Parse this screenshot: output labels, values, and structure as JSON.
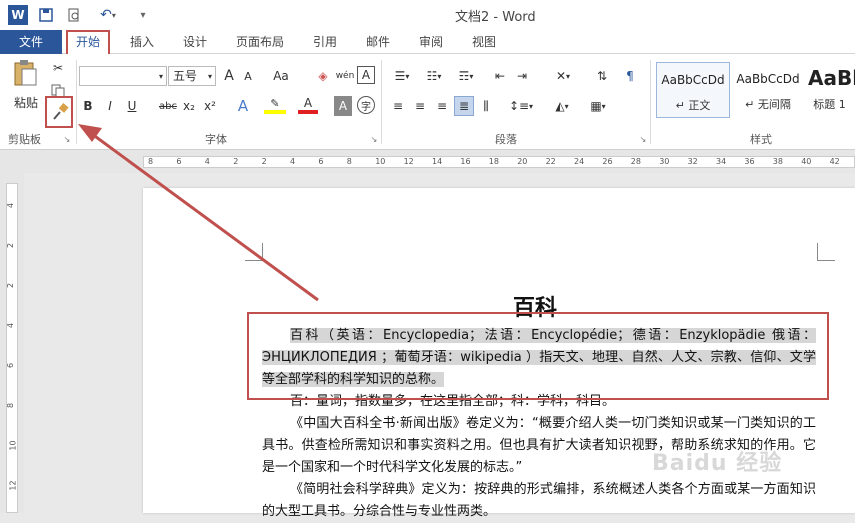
{
  "app": {
    "title": "文档2 - Word"
  },
  "tabs": {
    "file": "文件",
    "home": "开始",
    "insert": "插入",
    "design": "设计",
    "layout": "页面布局",
    "references": "引用",
    "mailings": "邮件",
    "review": "审阅",
    "view": "视图"
  },
  "ribbon": {
    "clipboard": {
      "label": "剪贴板",
      "paste": "粘贴"
    },
    "font": {
      "label": "字体",
      "family": "",
      "size": "五号",
      "bold": "B",
      "italic": "I",
      "underline": "U",
      "strike": "abc",
      "sub": "x₂",
      "sup": "x²",
      "grow": "A",
      "shrink": "A",
      "case": "Aa",
      "phonetic": "wén",
      "border_char": "A",
      "effect": "A",
      "color": "A",
      "shade": "A",
      "circle": "字"
    },
    "paragraph": {
      "label": "段落"
    },
    "styles": {
      "label": "样式",
      "items": [
        {
          "sample": "AaBbCcDd",
          "name": "↵ 正文"
        },
        {
          "sample": "AaBbCcDd",
          "name": "↵ 无间隔"
        },
        {
          "sample": "AaBl",
          "name": "标题 1"
        }
      ]
    }
  },
  "ruler": {
    "marks": [
      "8",
      "6",
      "4",
      "2",
      "2",
      "4",
      "6",
      "8",
      "10",
      "12",
      "14",
      "16",
      "18",
      "20",
      "22",
      "24",
      "26",
      "28",
      "30",
      "32",
      "34",
      "36",
      "38",
      "40",
      "42"
    ]
  },
  "vruler": {
    "marks": [
      "4",
      "2",
      "2",
      "4",
      "6",
      "8",
      "10",
      "12"
    ]
  },
  "document": {
    "heading": "百科",
    "p1": "百科（英语：Encyclopedia；法语：Encyclopédie；德语：Enzyklopädie 俄语： ЭНЦИКЛОПЕДИЯ ；葡萄牙语：wikipedia ）指天文、地理、自然、人文、宗教、信仰、文学等全部学科的科学知识的总称。",
    "p2": "百：量词，指数量多，在这里指全部；科：学科，科目。",
    "p3": "《中国大百科全书·新闻出版》卷定义为：“概要介绍人类一切门类知识或某一门类知识的工具书。供查检所需知识和事实资料之用。但也具有扩大读者知识视野，帮助系统求知的作用。它是一个国家和一个时代科学文化发展的标志。”",
    "p4": "《简明社会科学辞典》定义为：按辞典的形式编排，系统概述人类各个方面或某一方面知识的大型工具书。分综合性与专业性两类。"
  },
  "watermark": "Baidu 经验",
  "colors": {
    "accent": "#2b579a",
    "highlight": "#c0504d"
  }
}
